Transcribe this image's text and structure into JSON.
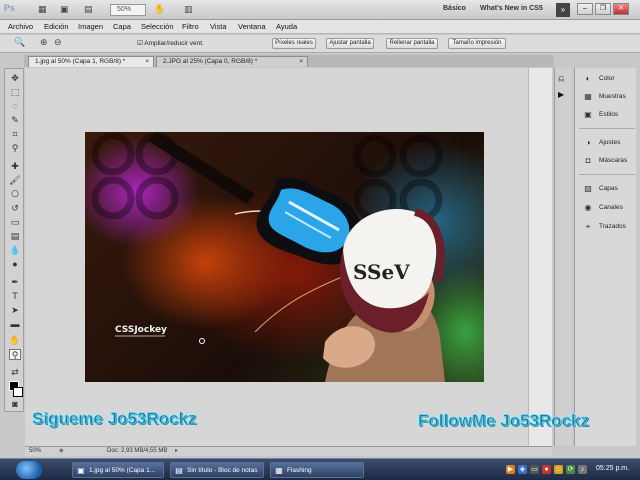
{
  "app": {
    "logo": "Ps",
    "zoom_dropdown": "50%",
    "workspaces": [
      "Básico",
      "What's New in CS5"
    ]
  },
  "menu": [
    "Archivo",
    "Edición",
    "Imagen",
    "Capa",
    "Selección",
    "Filtro",
    "Vista",
    "Ventana",
    "Ayuda"
  ],
  "options_bar": {
    "resize_checkbox": "Ampliar/reducir vent.",
    "buttons": [
      "Píxeles reales",
      "Ajustar pantalla",
      "Rellenar pantalla",
      "Tamaño impresión"
    ]
  },
  "tabs": [
    {
      "label": "1.jpg al 50% (Capa 1, RGB/8) *"
    },
    {
      "label": "2.JPG al 25% (Capa 0, RGB/8) *"
    }
  ],
  "image_text": {
    "logo": "CSSJockey",
    "cap": "SSeV"
  },
  "captions": {
    "left": "Sigueme Jo53Rockz",
    "right": "FollowMe Jo53Rockz"
  },
  "panels": {
    "group1": [
      "Color",
      "Muestras",
      "Estilos"
    ],
    "group2": [
      "Ajustes",
      "Máscaras"
    ],
    "group3": [
      "Capas",
      "Canales",
      "Trazados"
    ]
  },
  "status": {
    "zoom": "50%",
    "doc": "Doc: 2,93 MB/4,55 MB"
  },
  "taskbar": {
    "tasks": [
      "1.jpg al 50% (Capa 1...",
      "Sin título - Bloc de notas",
      "Flashing"
    ],
    "clock": "05:25 p.m."
  }
}
